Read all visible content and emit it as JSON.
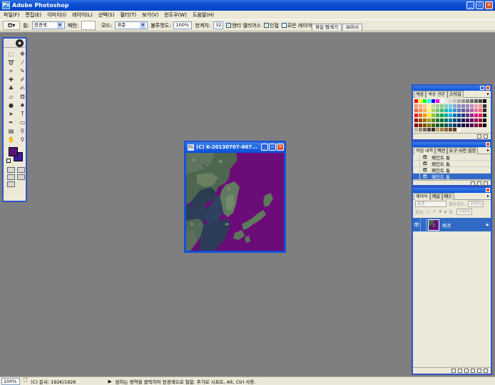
{
  "window": {
    "title": "Adobe Photoshop"
  },
  "menu": [
    "파일(F)",
    "편집(E)",
    "이미지(I)",
    "레이어(L)",
    "선택(S)",
    "필터(T)",
    "보기(V)",
    "윈도우(W)",
    "도움말(H)"
  ],
  "options": {
    "fill_label": "칠:",
    "fill_value": "전경색",
    "pattern_label": "패턴:",
    "mode_label": "모드:",
    "mode_value": "표준",
    "opacity_label": "불투명도:",
    "opacity_value": "100%",
    "tolerance_label": "한계치:",
    "tolerance_value": "32",
    "antialias_label": "앤티 앨리어스",
    "contiguous_label": "인접",
    "all_layers_label": "모든 레이어",
    "well_tabs": [
      "파일 탐색기",
      "브러시"
    ]
  },
  "document": {
    "title": "(C) K-20130707-667..."
  },
  "swatches_palette": {
    "tabs": [
      "색상",
      "색상 견본",
      "스타일"
    ],
    "colors": [
      "#ff0000",
      "#ffff00",
      "#00ff00",
      "#00ffff",
      "#0000ff",
      "#ff00ff",
      "#ffffff",
      "#ebebeb",
      "#d6d6d6",
      "#c2c2c2",
      "#adadad",
      "#999999",
      "#858585",
      "#707070",
      "#5c5c5c",
      "#474747",
      "#000000",
      "#f7977a",
      "#f9ad81",
      "#fdc68a",
      "#fff79a",
      "#c4df9b",
      "#a2d39c",
      "#82ca9d",
      "#7bcdc8",
      "#6ecff6",
      "#7ea7d8",
      "#8493ca",
      "#8882be",
      "#a187be",
      "#bc8dbf",
      "#f49ac2",
      "#f6989d",
      "#363636",
      "#f26c4f",
      "#f68e55",
      "#fbaf5c",
      "#fff467",
      "#acd372",
      "#7cc576",
      "#3bb878",
      "#1abbb4",
      "#00bff3",
      "#438ccb",
      "#5574b9",
      "#605ca8",
      "#855fa8",
      "#a763a8",
      "#f06eaa",
      "#f26d7d",
      "#262626",
      "#ed1c24",
      "#f26522",
      "#f7941d",
      "#fff200",
      "#8dc73f",
      "#39b54a",
      "#00a651",
      "#00a99d",
      "#00aeef",
      "#0072bc",
      "#0054a6",
      "#2e3192",
      "#662d91",
      "#92278f",
      "#ec008c",
      "#ed145b",
      "#1a1a1a",
      "#9e0b0f",
      "#a0410d",
      "#a3620a",
      "#aba000",
      "#598527",
      "#197b30",
      "#007236",
      "#00746b",
      "#0076a3",
      "#004a80",
      "#003471",
      "#1b1464",
      "#440e62",
      "#630460",
      "#9e005d",
      "#9e0039",
      "#0d0d0d",
      "#790000",
      "#7b2e00",
      "#7d4900",
      "#827b00",
      "#406618",
      "#005e20",
      "#005826",
      "#005952",
      "#005b7f",
      "#003663",
      "#002157",
      "#0d004c",
      "#32004b",
      "#4b0049",
      "#7b0046",
      "#7a0026",
      "#000000",
      "#c7b299",
      "#998675",
      "#736357",
      "#534741",
      "#37302a",
      "#c69c6d",
      "#a67c52",
      "#8c6239",
      "#754c24",
      "#603913",
      "#ffffff",
      "#ece9d8",
      "#ece9d8",
      "#ece9d8",
      "#ece9d8",
      "#ece9d8",
      "#ece9d8"
    ]
  },
  "history_palette": {
    "tabs": [
      "작업 내역",
      "액션",
      "도구 사전 설정"
    ],
    "items": [
      "페인트 통",
      "페인트 통",
      "페인트 통",
      "페인트 통"
    ]
  },
  "layers_palette": {
    "tabs": [
      "레이어",
      "채널",
      "패스"
    ],
    "blend_mode": "표준",
    "opacity_label": "불투명도:",
    "opacity_value": "100%",
    "lock_label": "잠금:",
    "fill_label": "칠:",
    "fill_value": "100%",
    "layer_name": "배경"
  },
  "status": {
    "zoom": "100%",
    "doc_size": "(C) 문서: 192K/192K",
    "hint": "원하는 영역을 클릭하여 전경색으로 칠합. 추가로 시프트, Alt, Ctrl 사용."
  }
}
